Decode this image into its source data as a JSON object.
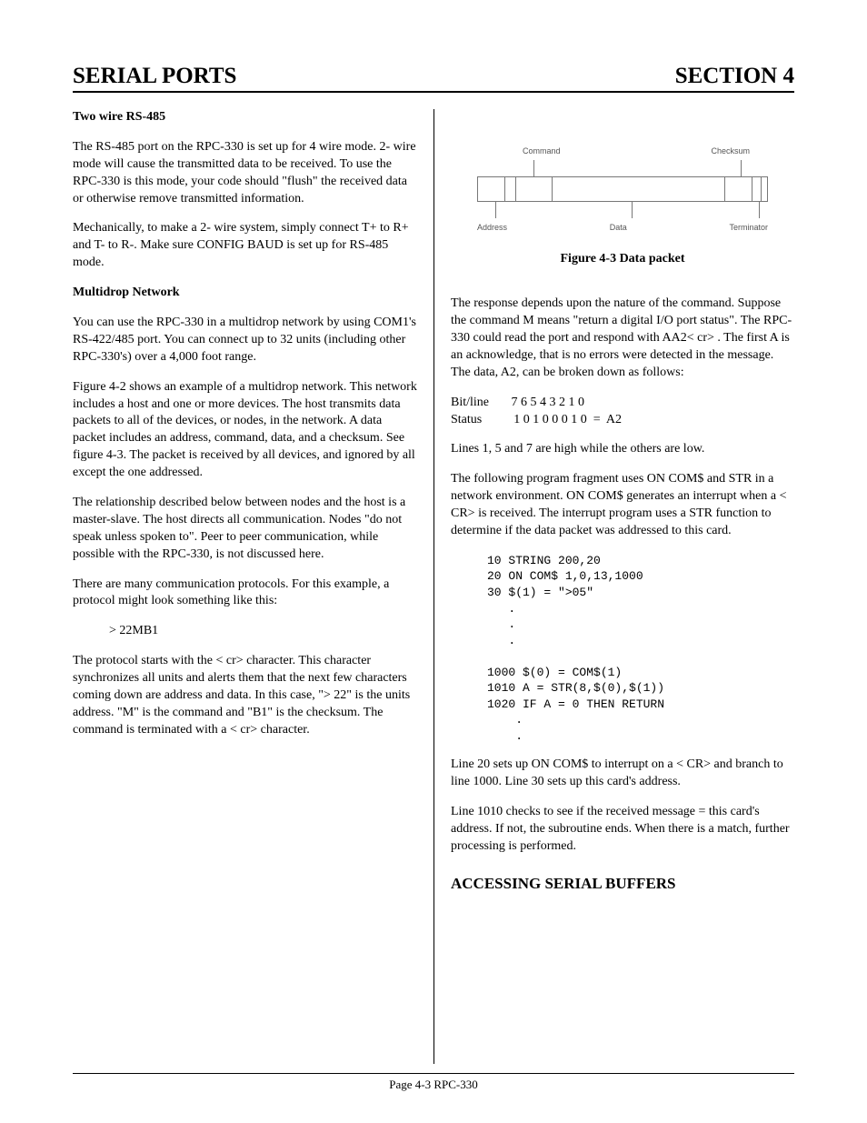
{
  "header": {
    "left": "SERIAL PORTS",
    "right": "SECTION 4"
  },
  "left": {
    "h1": "Two wire RS-485",
    "p1": "The RS-485 port on the RPC-330 is set up for 4 wire mode.  2- wire mode will cause the transmitted data to be received.  To use the RPC-330 is this mode, your code should \"flush\" the received data or otherwise remove transmitted information.",
    "p2": "Mechanically, to make a 2- wire system, simply connect T+  to R+  and T- to R-.  Make sure CONFIG BAUD is set up for RS-485 mode.",
    "h2": "Multidrop Network",
    "p3": "You can use the RPC-330 in a multidrop network by using COM1's RS-422/485 port.  You can connect up to 32 units (including other RPC-330's) over a 4,000 foot range.",
    "p4": "Figure 4-2 shows an example of a multidrop network. This network includes a host and one or more devices. The host transmits data packets to all of the devices, or nodes, in the network.  A data packet includes an address, command, data, and a checksum.  See figure 4-3.  The packet is received by all devices, and ignored by all except the one addressed.",
    "p5": "The relationship described below between nodes and the host is a master-slave.  The host directs all communication.  Nodes \"do not speak unless spoken to\". Peer to peer communication, while possible with the RPC-330, is not discussed here.",
    "p6": "There are many communication protocols.  For this example, a protocol might look something like this:",
    "proto": "> 22MB1",
    "p7": "The protocol starts with the < cr>  character.  This character synchronizes all units and alerts them that the next few characters coming down are address and data. In this case, \"> 22\" is the units address.  \"M\" is the command and \"B1\" is the checksum.  The command is terminated with a < cr>  character."
  },
  "right": {
    "fig": {
      "top_left": "Command",
      "top_right": "Checksum",
      "bot_left": "Address",
      "bot_mid": "Data",
      "bot_right": "Terminator",
      "caption": "Figure 4-3  Data packet"
    },
    "p1": "The response depends upon the nature of the command. Suppose the command M means \"return a digital I/O port status\".  The RPC-330 could read the port and respond with AA2< cr> .  The first A is an acknowledge, that is no errors were detected in the message.  The data, A2, can be broken down as follows:",
    "bits": "Bit/line       7 6 5 4 3 2 1 0\nStatus          1 0 1 0 0 0 1 0  =  A2",
    "p2": "Lines 1, 5 and 7 are high while the others are low.",
    "p3": "The following program fragment uses ON COM$ and STR in a network environment.  ON COM$ generates an interrupt when a < CR>  is received.  The interrupt program uses a STR function to determine if the data packet was addressed to this card.",
    "code": "10 STRING 200,20\n20 ON COM$ 1,0,13,1000\n30 $(1) = \">05\"\n   .\n   .\n   .\n\n1000 $(0) = COM$(1)\n1010 A = STR(8,$(0),$(1))\n1020 IF A = 0 THEN RETURN\n    .\n    .",
    "p4": "Line 20 sets up ON COM$ to interrupt on a < CR>  and branch to line 1000.  Line 30 sets up this card's address.",
    "p5": "Line 1010 checks to see if the received message =  this card's address.  If not, the subroutine ends.  When there is a match, further processing is performed.",
    "h1": "ACCESSING SERIAL BUFFERS"
  },
  "footer": "Page 4-3   RPC-330"
}
